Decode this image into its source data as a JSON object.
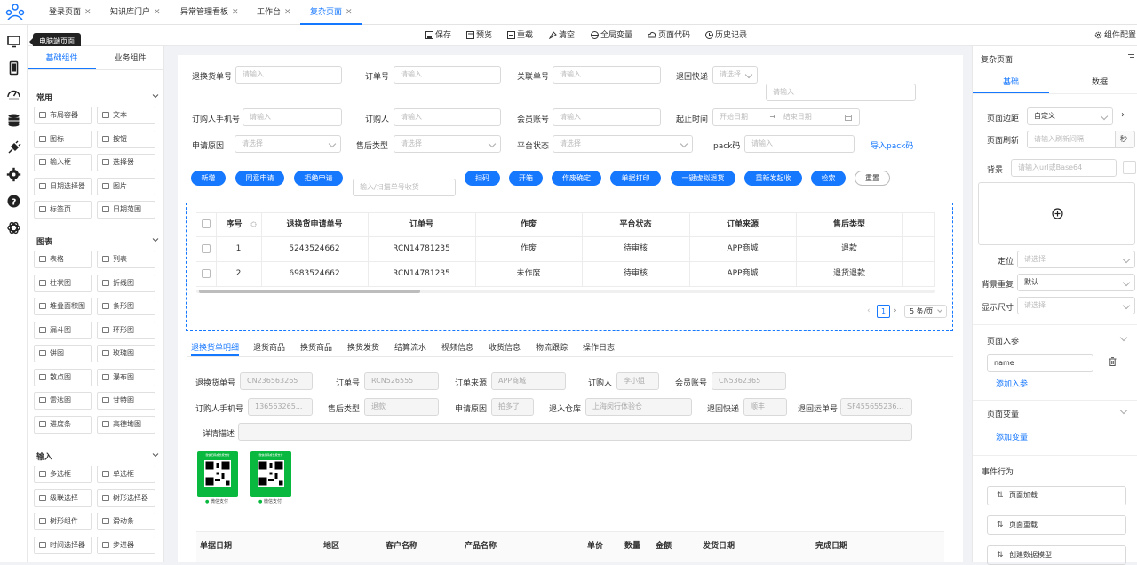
{
  "app": {
    "accent": "#1677ff"
  },
  "tabs": [
    {
      "label": "登录页面"
    },
    {
      "label": "知识库门户"
    },
    {
      "label": "异常管理看板"
    },
    {
      "label": "工作台"
    },
    {
      "label": "复杂页面"
    }
  ],
  "toolbar": {
    "save": "保存",
    "preview": "预览",
    "reload": "重载",
    "clear": "清空",
    "globals": "全局变量",
    "code": "页面代码",
    "history": "历史记录",
    "component_config": "组件配置"
  },
  "rail": {
    "tooltip": "电脑端页面",
    "icons": [
      "desktop-icon",
      "mobile-icon",
      "dashboard-icon",
      "database-icon",
      "plugin-icon",
      "gear-icon",
      "help-icon",
      "openai-icon"
    ]
  },
  "components": {
    "tab_basic": "基础组件",
    "tab_business": "业务组件",
    "sections": [
      {
        "title": "常用",
        "items": [
          "布局容器",
          "文本",
          "图标",
          "按钮",
          "输入框",
          "选择器",
          "日期选择器",
          "图片",
          "标签页",
          "日期范围"
        ]
      },
      {
        "title": "图表",
        "items": [
          "表格",
          "列表",
          "柱状图",
          "折线图",
          "堆叠面积图",
          "条形图",
          "漏斗图",
          "环形图",
          "饼图",
          "玫瑰图",
          "散点图",
          "瀑布图",
          "雷达图",
          "甘特图",
          "进度条",
          "高德地图"
        ]
      },
      {
        "title": "输入",
        "items": [
          "多选框",
          "单选框",
          "级联选择",
          "树形选择器",
          "树形组件",
          "滑动条",
          "时间选择器",
          "步进器"
        ]
      }
    ]
  },
  "form": {
    "return_no": {
      "label": "退换货单号",
      "placeholder": "请输入"
    },
    "order_no": {
      "label": "订单号",
      "placeholder": "请输入"
    },
    "related_no": {
      "label": "关联单号",
      "placeholder": "请输入"
    },
    "return_express": {
      "label": "退回快递",
      "placeholder": "请选择",
      "placeholder2": "请输入"
    },
    "buyer_phone": {
      "label": "订购人手机号",
      "placeholder": "请输入"
    },
    "buyer": {
      "label": "订购人",
      "placeholder": "请输入"
    },
    "member": {
      "label": "会员账号",
      "placeholder": "请输入"
    },
    "time_range": {
      "label": "起止时间",
      "start": "开始日期",
      "sep": "→",
      "end": "结束日期"
    },
    "reason": {
      "label": "申请原因",
      "placeholder": "请选择"
    },
    "after_type": {
      "label": "售后类型",
      "placeholder": "请选择"
    },
    "platform_status": {
      "label": "平台状态",
      "placeholder": "请选择"
    },
    "pack": {
      "label": "pack码",
      "placeholder": "请输入"
    },
    "import_pack": "导入pack码"
  },
  "actions": {
    "add": "新增",
    "approve": "同意申请",
    "reject": "拒绝申请",
    "scan_placeholder": "输入/扫描单号收货",
    "scan": "扫码",
    "open_box": "开箱",
    "void_confirm": "作废确定",
    "print": "单据打印",
    "virtual_return": "一键虚拟退货",
    "resend": "重新发起收",
    "search": "检索",
    "reset": "重置"
  },
  "table": {
    "headers": [
      "序号",
      "退换货申请单号",
      "订单号",
      "作废",
      "平台状态",
      "订单来源",
      "售后类型"
    ],
    "rows": [
      [
        "1",
        "5243524662",
        "RCN14781235",
        "作废",
        "待审核",
        "APP商城",
        "退款"
      ],
      [
        "2",
        "6983524662",
        "RCN14781235",
        "未作废",
        "待审核",
        "APP商城",
        "退货退款"
      ]
    ],
    "pagination": {
      "page": "1",
      "page_size": "5 条/页"
    }
  },
  "detail_tabs": [
    "退换货单明细",
    "退货商品",
    "换货商品",
    "换货发货",
    "结算流水",
    "视频信息",
    "收货信息",
    "物流跟踪",
    "操作日志"
  ],
  "detail": {
    "return_no": {
      "label": "退换货单号",
      "value": "CN236563265"
    },
    "order_no": {
      "label": "订单号",
      "value": "RCN526555"
    },
    "source": {
      "label": "订单来源",
      "value": "APP商城"
    },
    "buyer": {
      "label": "订购人",
      "value": "李小姐"
    },
    "member": {
      "label": "会员账号",
      "value": "CN5362365"
    },
    "phone": {
      "label": "订购人手机号",
      "value": "136563265..."
    },
    "after_type": {
      "label": "售后类型",
      "value": "退款"
    },
    "reason": {
      "label": "申请原因",
      "value": "拍多了"
    },
    "warehouse": {
      "label": "退入仓库",
      "value": "上海闵行体验仓"
    },
    "express": {
      "label": "退回快递",
      "value": "顺丰"
    },
    "waybill": {
      "label": "退回运单号",
      "value": "SF455655236..."
    },
    "desc": {
      "label": "详情描述",
      "value": ""
    },
    "qr_title": "微信扫码或长按支付",
    "qr_label": "微信支付"
  },
  "lower_table": {
    "headers": [
      "单据日期",
      "地区",
      "客户名称",
      "产品名称",
      "单价",
      "数量",
      "金额",
      "发货日期",
      "完成日期"
    ]
  },
  "right_panel": {
    "title": "复杂页面",
    "tab_basic": "基础",
    "tab_data": "数据",
    "margin_label": "页面边距",
    "margin_value": "自定义",
    "refresh_label": "页面刷新",
    "refresh_placeholder": "请输入刷新间隔",
    "refresh_unit": "秒",
    "bg_label": "背景",
    "bg_placeholder": "请输入url或Base64",
    "pos_label": "定位",
    "pos_placeholder": "请选择",
    "repeat_label": "背景重复",
    "repeat_value": "默认",
    "size_label": "显示尺寸",
    "size_placeholder": "请选择",
    "params_title": "页面入参",
    "param_name": "name",
    "add_param": "添加入参",
    "vars_title": "页面变量",
    "add_var": "添加变量",
    "events_title": "事件行为",
    "events": [
      "页面加载",
      "页面重载",
      "创建数据模型"
    ]
  }
}
